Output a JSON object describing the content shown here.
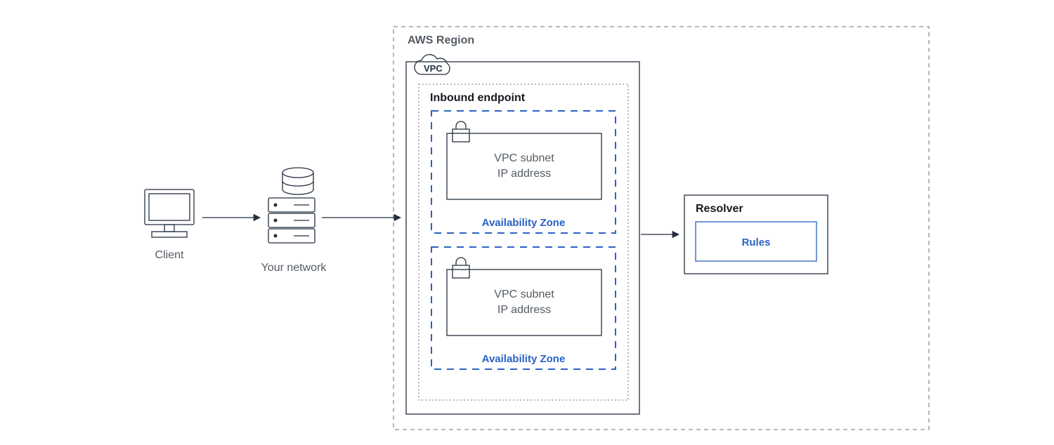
{
  "labels": {
    "client": "Client",
    "your_network": "Your network",
    "aws_region": "AWS Region",
    "vpc": "VPC",
    "inbound_endpoint": "Inbound endpoint",
    "az": "Availability Zone",
    "subnet1_line1": "VPC subnet",
    "subnet1_line2": "IP address",
    "subnet2_line1": "VPC subnet",
    "subnet2_line2": "IP address",
    "resolver": "Resolver",
    "rules": "Rules"
  }
}
